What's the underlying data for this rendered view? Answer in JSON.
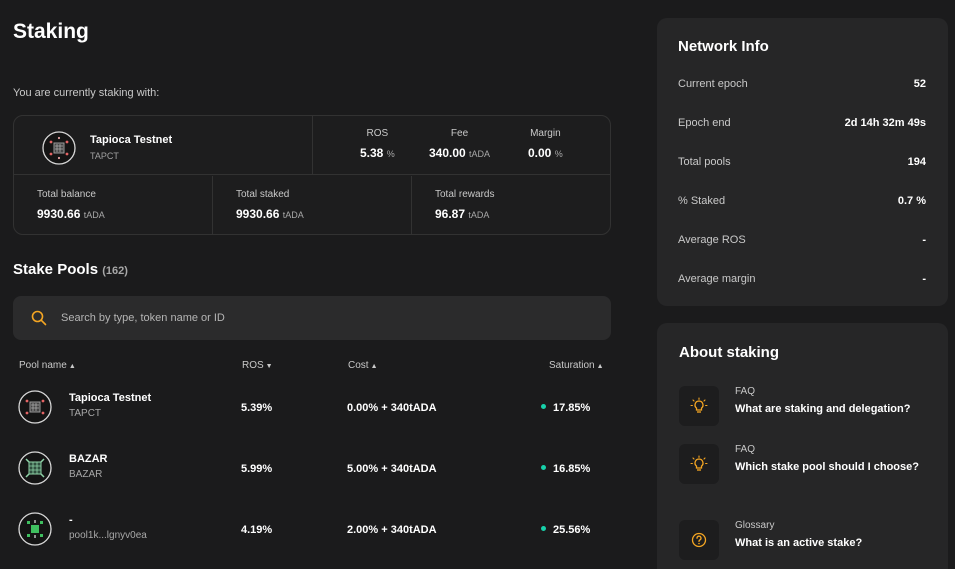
{
  "page": {
    "title": "Staking"
  },
  "current_delegation": {
    "label": "You are currently staking with:",
    "pool_name": "Tapioca Testnet",
    "pool_ticker": "TAPCT",
    "ros": {
      "label": "ROS",
      "value": "5.38",
      "unit": "%"
    },
    "fee": {
      "label": "Fee",
      "value": "340.00",
      "unit": "tADA"
    },
    "margin": {
      "label": "Margin",
      "value": "0.00",
      "unit": "%"
    },
    "total_balance": {
      "label": "Total balance",
      "value": "9930.66",
      "unit": "tADA"
    },
    "total_staked": {
      "label": "Total staked",
      "value": "9930.66",
      "unit": "tADA"
    },
    "total_rewards": {
      "label": "Total rewards",
      "value": "96.87",
      "unit": "tADA"
    }
  },
  "stake_pools": {
    "title": "Stake Pools",
    "count": "(162)",
    "search_placeholder": "Search by type, token name or ID",
    "columns": {
      "name": "Pool name",
      "ros": "ROS",
      "cost": "Cost",
      "saturation": "Saturation"
    },
    "rows": [
      {
        "name": "Tapioca Testnet",
        "ticker": "TAPCT",
        "ros": "5.39%",
        "cost": "0.00% + 340tADA",
        "saturation": "17.85%",
        "status_color": "#17d1aa"
      },
      {
        "name": "BAZAR",
        "ticker": "BAZAR",
        "ros": "5.99%",
        "cost": "5.00% + 340tADA",
        "saturation": "16.85%",
        "status_color": "#17d1aa"
      },
      {
        "name": "-",
        "ticker": "pool1k...lgnyv0ea",
        "ros": "4.19%",
        "cost": "2.00% + 340tADA",
        "saturation": "25.56%",
        "status_color": "#17d1aa"
      }
    ]
  },
  "network_info": {
    "title": "Network Info",
    "rows": [
      {
        "label": "Current epoch",
        "value": "52"
      },
      {
        "label": "Epoch end",
        "value": "2d 14h 32m 49s"
      },
      {
        "label": "Total pools",
        "value": "194"
      },
      {
        "label": "% Staked",
        "value": "0.7 %"
      },
      {
        "label": "Average ROS",
        "value": "-"
      },
      {
        "label": "Average margin",
        "value": "-"
      }
    ]
  },
  "about_staking": {
    "title": "About staking",
    "items": [
      {
        "category": "FAQ",
        "question": "What are staking and delegation?",
        "icon": "lightbulb-icon"
      },
      {
        "category": "FAQ",
        "question": "Which stake pool should I choose?",
        "icon": "lightbulb-icon"
      },
      {
        "category": "Glossary",
        "question": "What is an active stake?",
        "icon": "question-circle-icon"
      }
    ]
  },
  "colors": {
    "background": "#1b1b1c",
    "card": "#262627",
    "accent": "#f5a623",
    "status_green": "#17d1aa"
  }
}
